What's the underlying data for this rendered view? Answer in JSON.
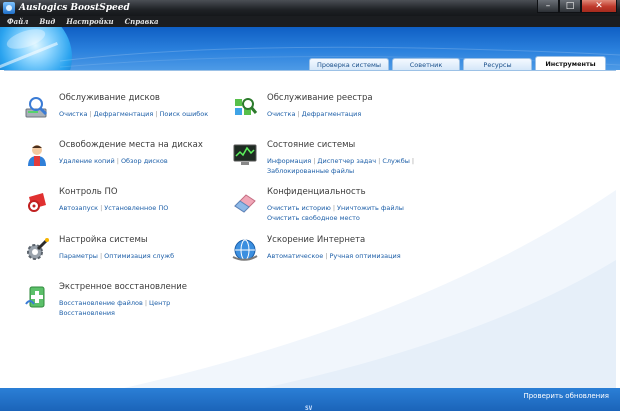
{
  "window": {
    "title": "Auslogics BoostSpeed",
    "minimize_glyph": "–",
    "maximize_glyph": "□",
    "close_glyph": "✕"
  },
  "menu": [
    "Файл",
    "Вид",
    "Настройки",
    "Справка"
  ],
  "tabs": [
    {
      "label": "Проверка системы",
      "active": false
    },
    {
      "label": "Советник",
      "active": false
    },
    {
      "label": "Ресурсы",
      "active": false
    },
    {
      "label": "Инструменты",
      "active": true
    }
  ],
  "groups": [
    {
      "title": "Обслуживание дисков",
      "icon": "disk-maintenance-icon",
      "links": [
        "Очистка",
        "Дефрагментация",
        "Поиск ошибок"
      ]
    },
    {
      "title": "Обслуживание реестра",
      "icon": "registry-maintenance-icon",
      "links": [
        "Очистка",
        "Дефрагментация"
      ]
    },
    {
      "title": "Освобождение места на дисках",
      "icon": "disk-space-icon",
      "links": [
        "Удаление копий",
        "Обзор дисков"
      ]
    },
    {
      "title": "Состояние системы",
      "icon": "system-state-icon",
      "links": [
        "Информация",
        "Диспетчер задач",
        "Службы",
        "Заблокированные файлы"
      ]
    },
    {
      "title": "Контроль ПО",
      "icon": "software-control-icon",
      "links": [
        "Автозапуск",
        "Установленное ПО"
      ]
    },
    {
      "title": "Конфиденциальность",
      "icon": "privacy-eraser-icon",
      "links": [
        "Очистить историю",
        "Уничтожить файлы",
        "Очистить свободное место"
      ]
    },
    {
      "title": "Настройка системы",
      "icon": "system-tweak-icon",
      "links": [
        "Параметры",
        "Оптимизация служб"
      ]
    },
    {
      "title": "Ускорение Интернета",
      "icon": "internet-speedup-icon",
      "links": [
        "Автоматическое",
        "Ручная оптимизация"
      ]
    },
    {
      "title": "Экстренное восстановление",
      "icon": "rescue-center-icon",
      "links": [
        "Восстановление файлов",
        "Центр",
        "Восстановления"
      ]
    }
  ],
  "status": {
    "check_updates": "Проверить обновления",
    "grip": "SV"
  }
}
